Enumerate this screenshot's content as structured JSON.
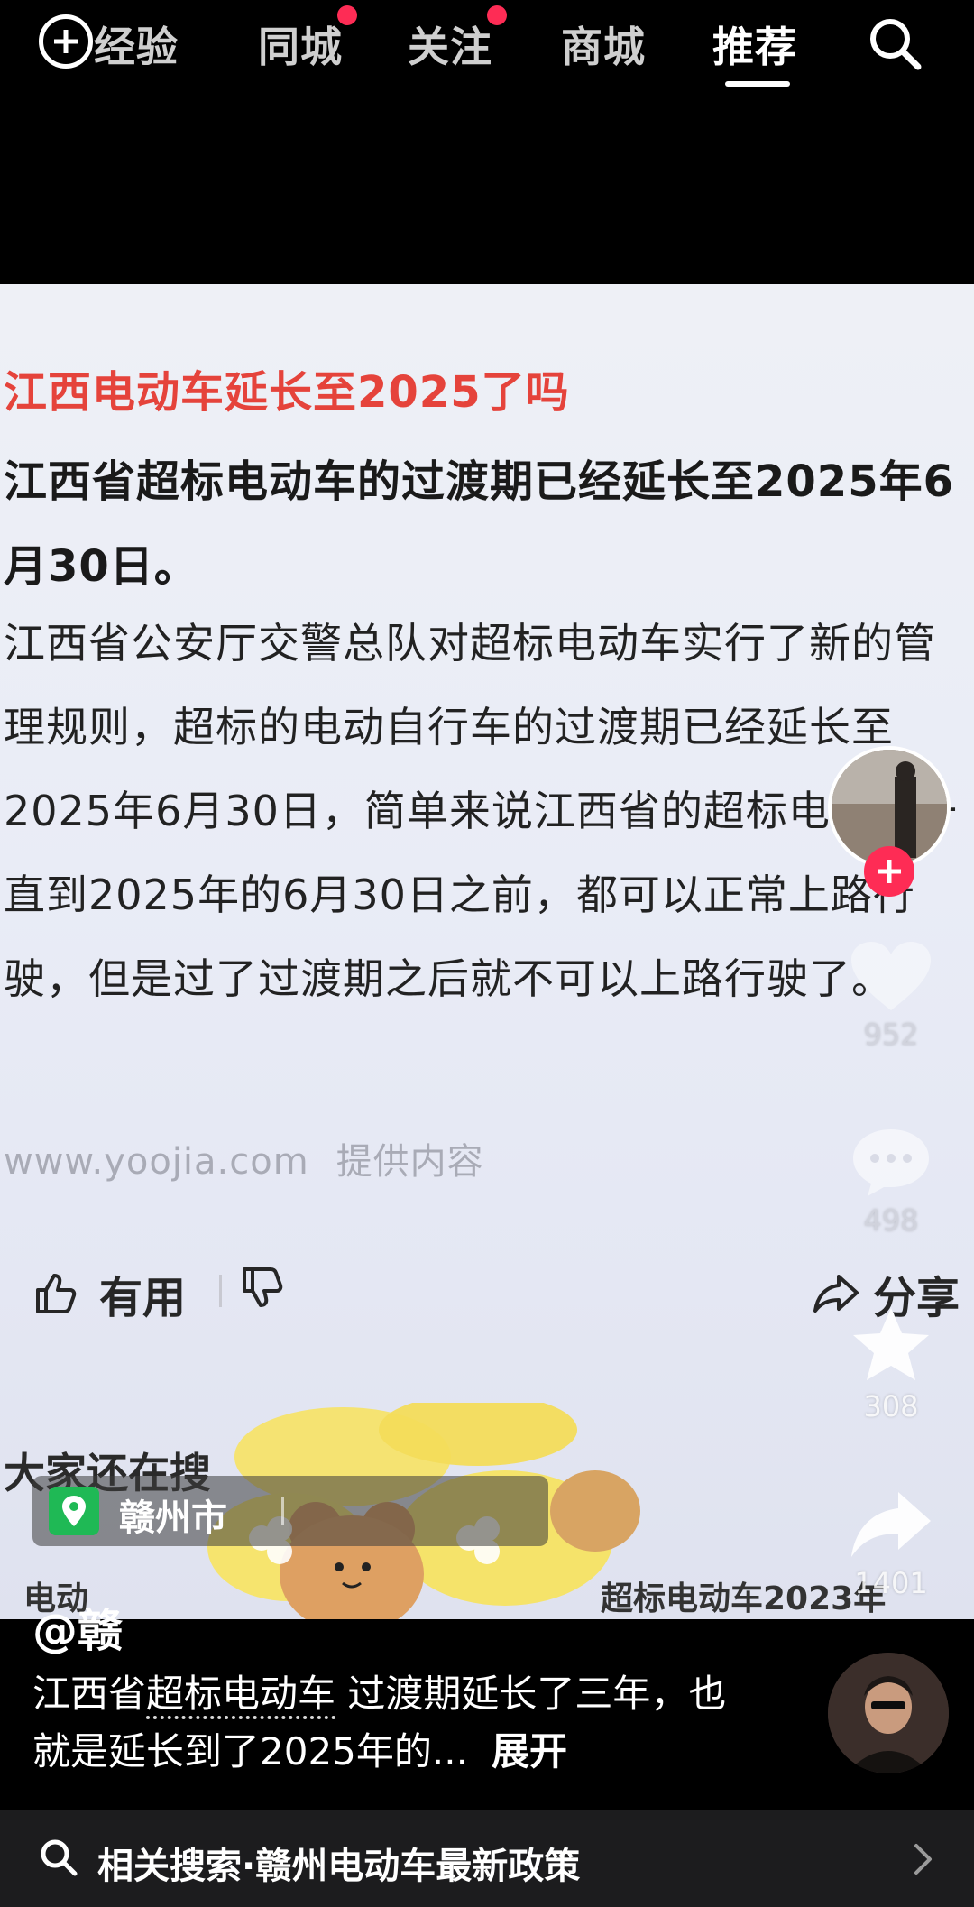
{
  "nav": {
    "tabs": [
      {
        "label": "经验",
        "dot": false
      },
      {
        "label": "同城",
        "dot": true
      },
      {
        "label": "关注",
        "dot": true
      },
      {
        "label": "商城",
        "dot": false
      },
      {
        "label": "推荐",
        "dot": false,
        "active": true
      }
    ]
  },
  "video": {
    "title": "江西电动车延长至2025了吗",
    "headline": "江西省超标电动车的过渡期已经延长至2025年6月30日。",
    "body": "江西省公安厅交警总队对超标电动车实行了新的管理规则，超标的电动自行车的过渡期已经延长至2025年6月30日，简单来说江西省的超标电动车一直到2025年的6月30日之前，都可以正常上路行驶，但是过了过渡期之后就不可以上路行驶了。",
    "source_site": "www.yoojia.com",
    "source_label": "提供内容",
    "useful_label": "有用",
    "share_label": "分享",
    "others_search": "大家还在搜",
    "bottom_left": "电动",
    "bottom_right": "超标电动车2023年"
  },
  "location": {
    "label": "赣州市"
  },
  "sidebar": {
    "likes": "952",
    "comments": "498",
    "favorites": "308",
    "shares": "1401"
  },
  "caption": {
    "author": "@赣",
    "pre": "江西省",
    "keyword": "超标电动车",
    "post": "过渡期延长了三年，也就是延长到了2025年的...",
    "expand": "展开"
  },
  "related": {
    "label": "相关搜索",
    "separator": "·",
    "query": "赣州电动车最新政策"
  },
  "colors": {
    "accent_red": "#fe2c55",
    "title_red": "#e5433b",
    "location_green": "#1fb955"
  },
  "icons": [
    "add-icon",
    "search-icon",
    "thumb-up-icon",
    "thumb-down-icon",
    "share-arrow-icon",
    "heart-icon",
    "comment-icon",
    "star-icon",
    "share-icon",
    "location-pin-icon",
    "chevron-right-icon"
  ]
}
